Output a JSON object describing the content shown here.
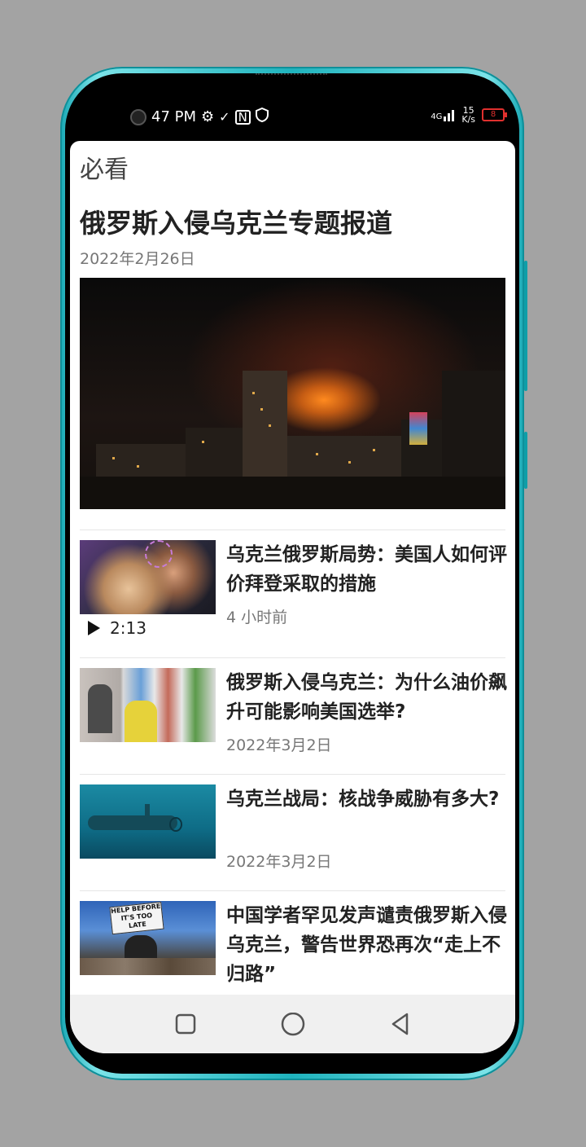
{
  "status_bar": {
    "time": "47 PM",
    "network_top": "4G",
    "speed_value": "15",
    "speed_unit": "K/s",
    "battery": "8",
    "icons": [
      "camera-icon",
      "gear-icon",
      "check-download-icon",
      "nfc-icon",
      "shield-icon",
      "signal-icon",
      "battery-icon"
    ]
  },
  "section": {
    "title": "必看"
  },
  "featured": {
    "headline": "俄罗斯入侵乌克兰专题报道",
    "date": "2022年2月26日"
  },
  "articles": [
    {
      "title": "乌克兰俄罗斯局势：美国人如何评价拜登采取的措施",
      "meta": "4 小时前",
      "video_duration": "2:13"
    },
    {
      "title": "俄罗斯入侵乌克兰：为什么油价飙升可能影响美国选举?",
      "meta": "2022年3月2日"
    },
    {
      "title": "乌克兰战局：核战争威胁有多大?",
      "meta": "2022年3月2日"
    },
    {
      "title": "中国学者罕见发声谴责俄罗斯入侵乌克兰，警告世界恐再次“走上不归路”",
      "meta": ""
    }
  ],
  "thumbnails": {
    "t4_sign": "HELP BEFORE IT'S TOO LATE"
  },
  "nav": {
    "icons": [
      "recents-icon",
      "home-icon",
      "back-icon"
    ]
  },
  "colors": {
    "frame": "#1fb3bd",
    "background": "#a3a3a3",
    "battery_low": "#e0302e"
  }
}
